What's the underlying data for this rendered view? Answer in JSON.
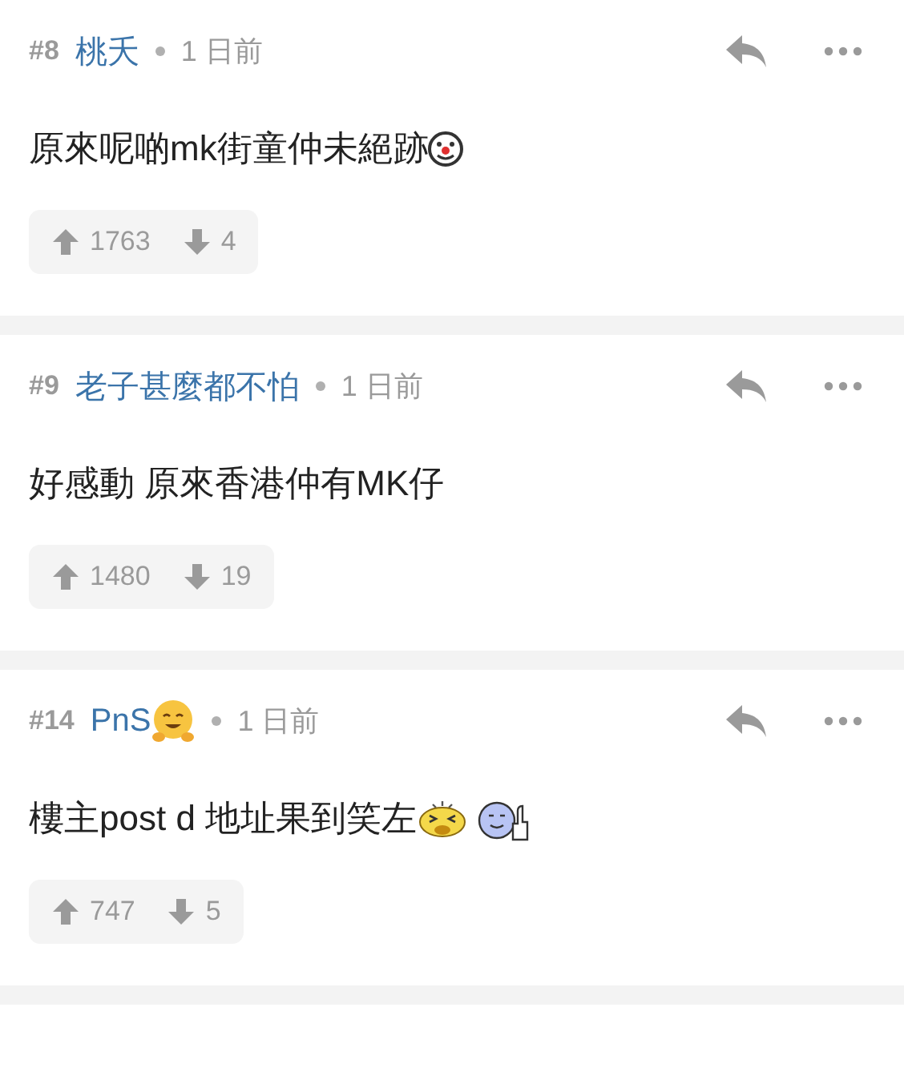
{
  "comments": [
    {
      "number": "#8",
      "author": "桃夭",
      "time": "1 日前",
      "body": "原來呢啲mk街童仲未絕跡",
      "body_icons": [
        {
          "kind": "clown"
        }
      ],
      "upvotes": "1763",
      "downvotes": "4"
    },
    {
      "number": "#9",
      "author": "老子甚麼都不怕",
      "time": "1 日前",
      "body": "好感動 原來香港仲有MK仔",
      "upvotes": "1480",
      "downvotes": "19"
    },
    {
      "number": "#14",
      "author": "PnS",
      "author_icon": {
        "kind": "hug"
      },
      "time": "1 日前",
      "body": "樓主post d 地址果到笑左",
      "body_icons": [
        {
          "kind": "laugh"
        },
        {
          "kind": "thumbs-up"
        }
      ],
      "upvotes": "747",
      "downvotes": "5"
    }
  ]
}
